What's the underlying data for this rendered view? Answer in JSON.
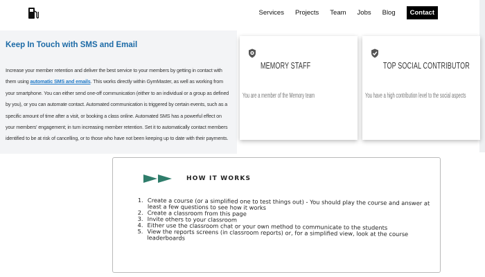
{
  "nav": {
    "items": [
      "Services",
      "Projects",
      "Team",
      "Jobs",
      "Blog"
    ],
    "contact_label": "Contact"
  },
  "sms": {
    "title": "Keep In Touch with SMS and Email",
    "body_before": "Increase your member retention and deliver the best service to your members by getting in contact with them using ",
    "body_highlight": "automatic SMS and emails",
    "body_after": ". This works directly within GymMaster, as well as working from your smartphone. You can either send one-off communication (either to an individual or a group as defined by you), or you can automate contact. Automated communication is triggered by certain events, such as a specific amount of time after a visit, or booking a class online. Automated SMS has a powerful effect on your members' engagement; in turn increasing member retention. Set it to automatically contact members identified to be at risk of cancelling, or to those who have not been keeping up to date with their payments."
  },
  "cards": [
    {
      "title": "MEMORY STAFF",
      "description": "You are a member of the Memory team",
      "icon": "memory-badge-icon"
    },
    {
      "title": "TOP SOCIAL CONTRIBUTOR",
      "description": "You have a high contribution level to the social aspects",
      "icon": "check-shield-icon"
    }
  ],
  "how_it_works": {
    "title": "HOW IT WORKS",
    "steps": [
      {
        "num": "1.",
        "text": "Create a course (or a simplified one to test things out) - You should play the course and answer at least a few questions to see how it works"
      },
      {
        "num": "2.",
        "text": "Create a classroom from this page"
      },
      {
        "num": "3.",
        "text": "Invite others to your classroom"
      },
      {
        "num": "4.",
        "text": "Either use the classroom chat or your own method to communicate to the students"
      },
      {
        "num": "5.",
        "text": "View the reports screens (in classroom reports) or, for a simplified view, look at the course leaderboards"
      }
    ]
  },
  "colors": {
    "accent": "#1c6aa6",
    "highlight": "#1e78c7",
    "arrow_green": "#2f7d6b",
    "panel_bg": "#f3f4f6"
  }
}
